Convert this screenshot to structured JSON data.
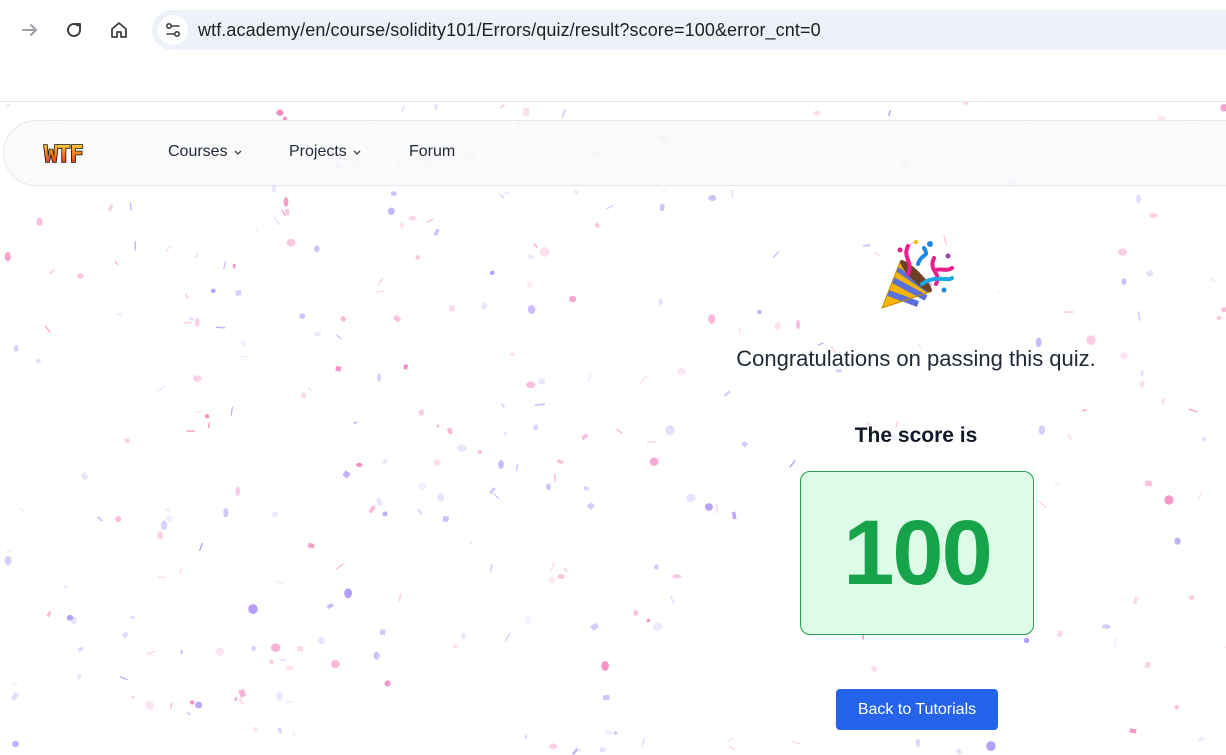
{
  "browser": {
    "url": "wtf.academy/en/course/solidity101/Errors/quiz/result?score=100&error_cnt=0",
    "forward_icon": "arrow-right-icon",
    "reload_icon": "reload-icon",
    "home_icon": "home-icon",
    "site_info_icon": "tune-icon"
  },
  "header": {
    "logo_text": "WTF",
    "nav": [
      {
        "label": "Courses",
        "has_dropdown": true
      },
      {
        "label": "Projects",
        "has_dropdown": true
      },
      {
        "label": "Forum",
        "has_dropdown": false
      }
    ]
  },
  "result": {
    "icon": "party-popper-icon",
    "congrats": "Congratulations on passing this quiz.",
    "score_label": "The score is",
    "score": "100",
    "back_button": "Back to Tutorials"
  },
  "colors": {
    "accent": "#2563eb",
    "score_green": "#16a34a",
    "score_bg": "#dcfce7",
    "confetti_pink": "#f9a8d4",
    "confetti_purple": "#c4b5fd"
  }
}
